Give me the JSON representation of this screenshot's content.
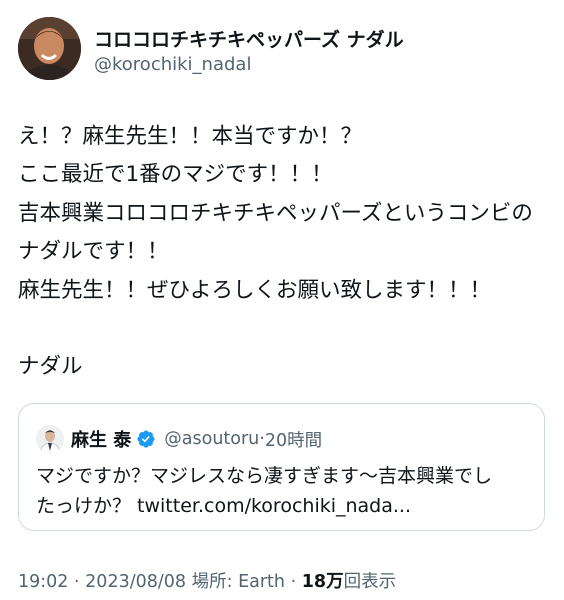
{
  "author": {
    "display_name": "コロコロチキチキペッパーズ ナダル",
    "handle": "@korochiki_nadal"
  },
  "tweet": {
    "lines": [
      "え！？麻生先生！！本当ですか！？",
      "ここ最近で1番のマジです！！！",
      "吉本興業コロコロチキチキペッパーズというコンビの",
      "ナダルです！！",
      "麻生先生！！ぜひよろしくお願い致します！！！",
      "",
      "ナダル"
    ]
  },
  "quote": {
    "name": "麻生 泰",
    "handle": "@asoutoru",
    "separator": "·",
    "time": "20時間",
    "lines": [
      "マジですか？マジレスなら凄すぎます〜吉本興業でし",
      "たっけか？ twitter.com/korochiki_nada..."
    ]
  },
  "meta": {
    "time": "19:02",
    "separator": "·",
    "date": "2023/08/08",
    "location_label": "場所: Earth",
    "separator2": "·",
    "views_count": "18万",
    "views_label": "回表示"
  },
  "colors": {
    "text": "#0f1419",
    "secondary": "#536471",
    "border": "#cfd9de",
    "verified": "#1d9bf0"
  },
  "icons": {
    "avatar": "avatar-photo",
    "quote_avatar": "avatar-photo",
    "verified": "verified-badge-icon"
  }
}
